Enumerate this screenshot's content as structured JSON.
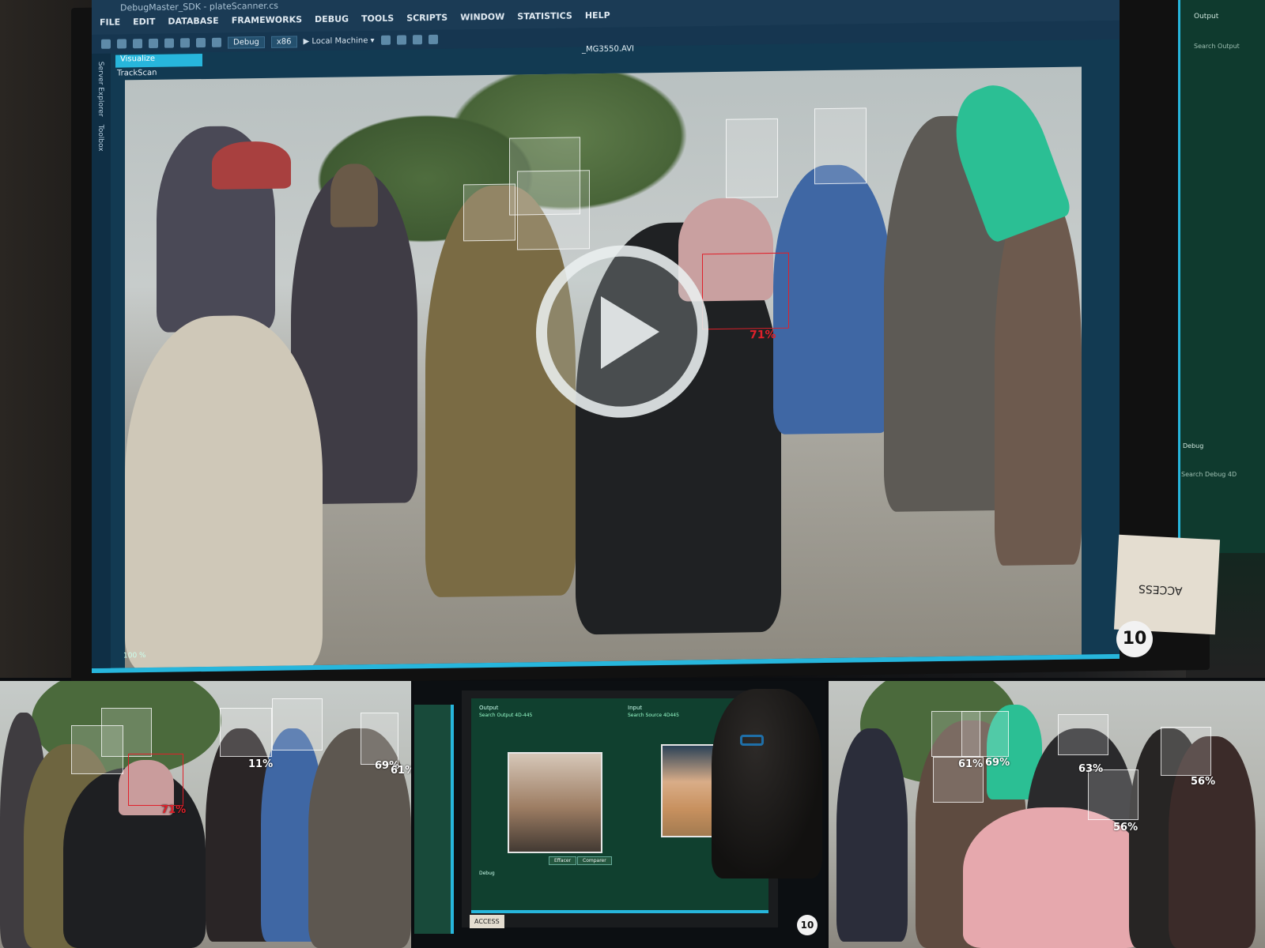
{
  "window": {
    "title": "DebugMaster_SDK - plateScanner.cs",
    "menus": [
      "FILE",
      "EDIT",
      "DATABASE",
      "FRAMEWORKS",
      "DEBUG",
      "TOOLS",
      "SCRIPTS",
      "WINDOW",
      "STATISTICS",
      "HELP"
    ]
  },
  "toolbar": {
    "config": "Debug",
    "platform": "x86",
    "run_target": "▶ Local Machine ▾"
  },
  "side_tabs": [
    "Server Explorer",
    "Toolbox"
  ],
  "document": {
    "tab": "Visualize",
    "file": "_MG3550.AVI",
    "panel": "TrackScan",
    "zoom": "100 %"
  },
  "detections": {
    "main_match": "71%"
  },
  "output_panel": {
    "title": "Output",
    "subtitle": "Search Output",
    "debug_title": "Debug",
    "debug_subtitle": "Search Debug 4D"
  },
  "sticker": {
    "text": "ACCESS"
  },
  "channel_badge": "10",
  "panel_left": {
    "labels": [
      "11%",
      "69%",
      "61%",
      "71%"
    ]
  },
  "panel_middle": {
    "labels": {
      "left_header": "Output",
      "left_sub": "Search Output 4D-445",
      "right_header": "Input",
      "right_sub": "Search Source 4D445",
      "btn1": "Effacer",
      "btn2": "Comparer",
      "output": "Debug"
    },
    "badge": "10",
    "sticker": "ACCESS"
  },
  "panel_right": {
    "labels": [
      "61%",
      "69%",
      "63%",
      "56%",
      "56%"
    ]
  },
  "colors": {
    "accent": "#27b6dc",
    "match_red": "#e0202a",
    "ide_bg": "#1b3b55"
  }
}
